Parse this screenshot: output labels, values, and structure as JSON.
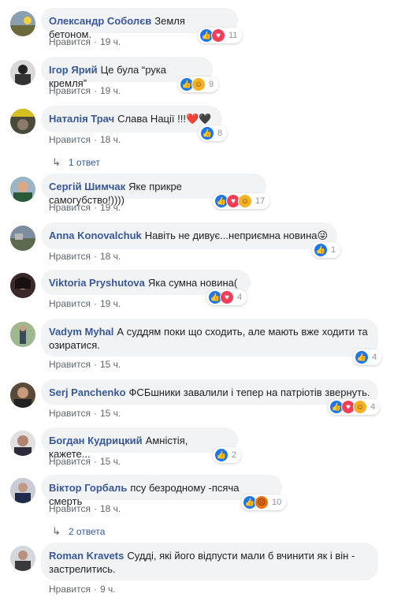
{
  "labels": {
    "like": "Нравится",
    "dot": "·"
  },
  "comments": [
    {
      "author": "Олександр Соболєв",
      "text": "Земля бетоном.",
      "time": "19 ч.",
      "reactions": [
        "like",
        "love"
      ],
      "count": "11"
    },
    {
      "author": "Ігор Ярий",
      "text": "Це була “рука кремля”",
      "time": "19 ч.",
      "reactions": [
        "like",
        "haha"
      ],
      "count": "9"
    },
    {
      "author": "Наталія Трач",
      "text": "Слава Нації !!!❤️🖤",
      "time": "18 ч.",
      "reactions": [
        "like"
      ],
      "count": "8",
      "replies": "1 ответ"
    },
    {
      "author": "Сергій Шимчак",
      "text": "Яке прикре самогубство!))))",
      "time": "19 ч.",
      "reactions": [
        "like",
        "love",
        "haha"
      ],
      "count": "17"
    },
    {
      "author": "Anna Konovalchuk",
      "text": "Навіть не дивує...неприємна новина😜",
      "time": "18 ч.",
      "reactions": [
        "like"
      ],
      "count": "1"
    },
    {
      "author": "Viktoria Pryshutova",
      "text": "Яка сумна новина(",
      "time": "19 ч.",
      "reactions": [
        "like",
        "love"
      ],
      "count": "4"
    },
    {
      "author": "Vadym Myhal",
      "text": "А суддям поки що сходить, але мають вже ходити та озиратися.",
      "time": "15 ч.",
      "reactions": [
        "like"
      ],
      "count": "4"
    },
    {
      "author": "Serj Panchenko",
      "text": "ФСБшники завалили і тепер на патріотів звернуть.",
      "time": "15 ч.",
      "reactions": [
        "like",
        "love",
        "haha"
      ],
      "count": "4"
    },
    {
      "author": "Богдан Кудрицкий",
      "text": "Амністія, кажете...",
      "time": "15 ч.",
      "reactions": [
        "like"
      ],
      "count": "2"
    },
    {
      "author": "Віктор Горбаль",
      "text": "псу безродному -псяча смерть",
      "time": "18 ч.",
      "reactions": [
        "like",
        "angry"
      ],
      "count": "10",
      "replies": "2 ответа"
    },
    {
      "author": "Roman Kravets",
      "text": "Судді, які його відпусти мали б вчинити як і він - застрелитись.",
      "time": "9 ч.",
      "reactions": [],
      "count": ""
    }
  ]
}
